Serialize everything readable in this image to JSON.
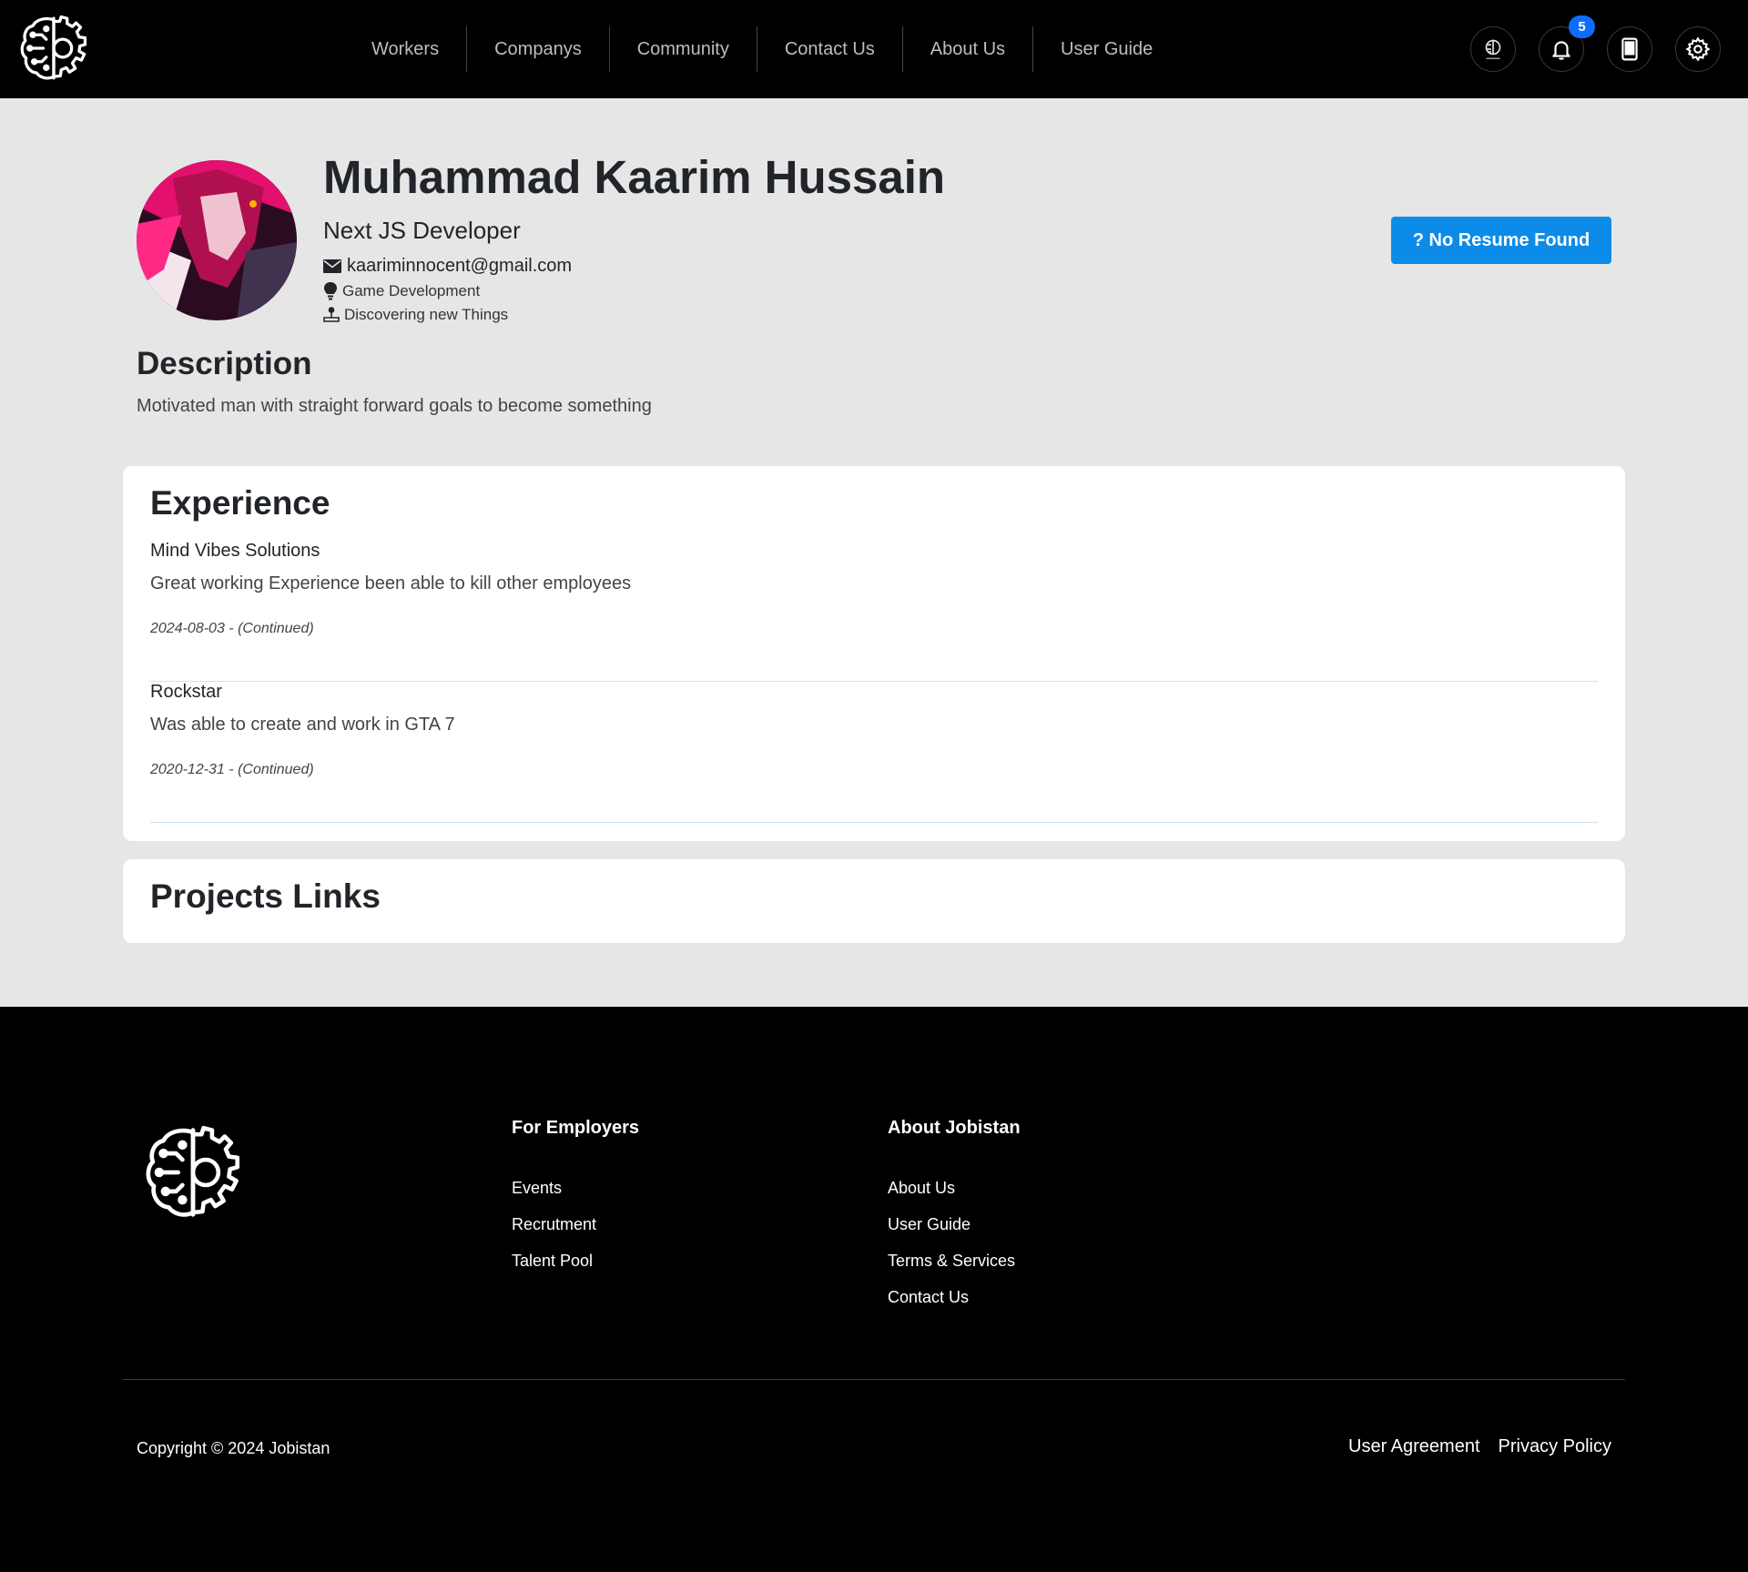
{
  "header": {
    "nav": [
      "Workers",
      "Companys",
      "Community",
      "Contact Us",
      "About Us",
      "User Guide"
    ],
    "notification_count": "5"
  },
  "profile": {
    "name": "Muhammad Kaarim Hussain",
    "role": "Next JS Developer",
    "email": "kaariminnocent@gmail.com",
    "interest": "Game Development",
    "hobby": "Discovering new Things",
    "resume_button": "? No Resume Found"
  },
  "description": {
    "title": "Description",
    "text": "Motivated man with straight forward goals to become something"
  },
  "experience": {
    "title": "Experience",
    "items": [
      {
        "company": "Mind Vibes Solutions",
        "desc": "Great working Experience been able to kill other employees",
        "date": "2024-08-03 - (Continued)"
      },
      {
        "company": "Rockstar",
        "desc": "Was able to create and work in GTA 7",
        "date": "2020-12-31 - (Continued)"
      }
    ]
  },
  "projects": {
    "title": "Projects Links"
  },
  "footer": {
    "employers": {
      "title": "For Employers",
      "links": [
        "Events",
        "Recrutment",
        "Talent Pool"
      ]
    },
    "about": {
      "title": "About Jobistan",
      "links": [
        "About Us",
        "User Guide",
        "Terms & Services",
        "Contact Us"
      ]
    },
    "copyright": "Copyright © 2024 Jobistan",
    "legal": [
      "User Agreement",
      "Privacy Policy"
    ]
  },
  "colors": {
    "accent": "#0d8be8",
    "badge": "#0d6efd",
    "header_bg": "#000000",
    "page_bg": "#e6e6e6"
  },
  "icons": [
    "brain-gear-logo-icon",
    "bell-icon",
    "phone-icon",
    "gear-icon",
    "envelope-icon",
    "lightbulb-icon",
    "joystick-icon"
  ]
}
